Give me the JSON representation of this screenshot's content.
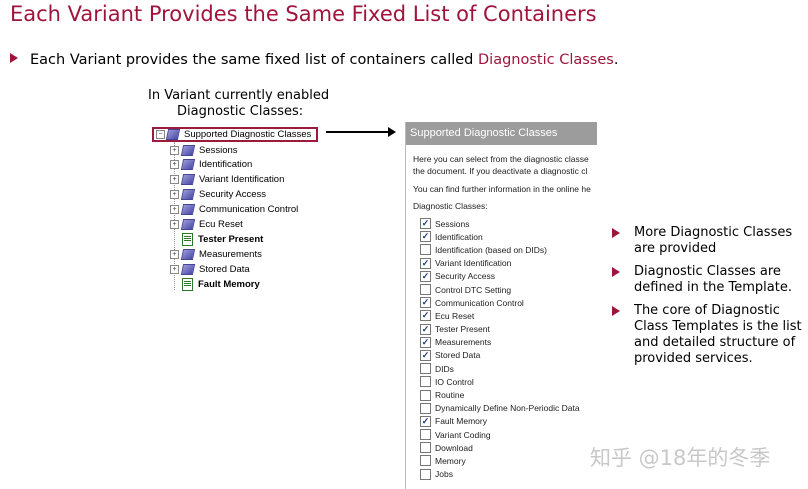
{
  "title": "Each Variant Provides the Same Fixed List of Containers",
  "main_bullet": {
    "text": "Each Variant provides the same fixed list of containers called ",
    "highlight": "Diagnostic Classes",
    "suffix": "."
  },
  "tree_caption": [
    "In Variant currently enabled",
    "Diagnostic Classes:"
  ],
  "tree": {
    "root": "Supported Diagnostic Classes",
    "items": [
      {
        "label": "Sessions",
        "bold": false,
        "icon": "class-icon"
      },
      {
        "label": "Identification",
        "bold": false,
        "icon": "class-icon"
      },
      {
        "label": "Variant Identification",
        "bold": false,
        "icon": "class-icon"
      },
      {
        "label": "Security Access",
        "bold": false,
        "icon": "class-icon"
      },
      {
        "label": "Communication Control",
        "bold": false,
        "icon": "class-icon"
      },
      {
        "label": "Ecu Reset",
        "bold": false,
        "icon": "class-icon"
      },
      {
        "label": "Tester Present",
        "bold": true,
        "icon": "document-icon"
      },
      {
        "label": "Measurements",
        "bold": false,
        "icon": "class-icon"
      },
      {
        "label": "Stored Data",
        "bold": false,
        "icon": "class-icon"
      },
      {
        "label": "Fault Memory",
        "bold": true,
        "icon": "document-icon"
      }
    ]
  },
  "panel": {
    "header": "Supported Diagnostic Classes",
    "text_line1": "Here you can select from the diagnostic classe",
    "text_line2": "the document. If you deactivate a diagnostic cl",
    "text_line3": "You can find further information in the online he",
    "list_label": "Diagnostic Classes:",
    "checkboxes": [
      {
        "label": "Sessions",
        "checked": true
      },
      {
        "label": "Identification",
        "checked": true
      },
      {
        "label": "Identification (based on DIDs)",
        "checked": false
      },
      {
        "label": "Variant Identification",
        "checked": true
      },
      {
        "label": "Security Access",
        "checked": true
      },
      {
        "label": "Control DTC Setting",
        "checked": false
      },
      {
        "label": "Communication Control",
        "checked": true
      },
      {
        "label": "Ecu Reset",
        "checked": true
      },
      {
        "label": "Tester Present",
        "checked": true
      },
      {
        "label": "Measurements",
        "checked": true
      },
      {
        "label": "Stored Data",
        "checked": true
      },
      {
        "label": "DIDs",
        "checked": false
      },
      {
        "label": "IO Control",
        "checked": false
      },
      {
        "label": "Routine",
        "checked": false
      },
      {
        "label": "Dynamically Define Non-Periodic Data",
        "checked": false
      },
      {
        "label": "Fault Memory",
        "checked": true
      },
      {
        "label": "Variant Coding",
        "checked": false
      },
      {
        "label": "Download",
        "checked": false
      },
      {
        "label": "Memory",
        "checked": false
      },
      {
        "label": "Jobs",
        "checked": false
      }
    ]
  },
  "right_bullets": [
    "More Diagnostic Classes are provided",
    "Diagnostic Classes are defined in the Template.",
    "The core of Diagnostic Class Templates is the list and detailed structure of provided services."
  ],
  "watermark": "知乎 @18年的冬季",
  "colors": {
    "accent": "#a0143c",
    "panel_header": "#9c9c9c"
  }
}
